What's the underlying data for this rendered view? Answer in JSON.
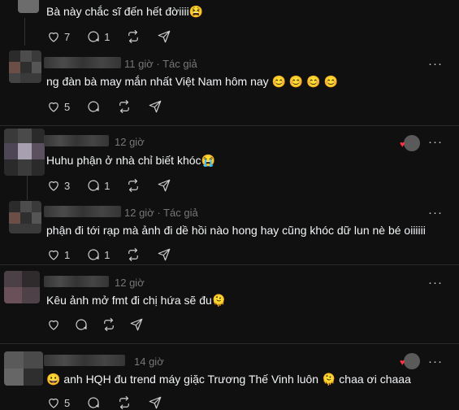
{
  "comments": [
    {
      "text": "Bà này chắc sĩ đến hết đời​iii😫",
      "time": "",
      "tag": "",
      "likes": "7",
      "replies": "1",
      "reposts": ""
    },
    {
      "text": "ng đàn bà may mắn nhất Việt Nam hôm nay 😊 😊 😊 😊",
      "time": "11 giờ",
      "tag": "· Tác giả",
      "likes": "5",
      "replies": "",
      "reposts": ""
    },
    {
      "text": "Huhu phận ở nhà chỉ biết khóc😭",
      "time": "12 giờ",
      "tag": "",
      "likes": "3",
      "replies": "1",
      "reposts": ""
    },
    {
      "text": "phận đi tới rạp mà ảnh đi dề hồi nào hong hay cũng khóc dữ lun nè bé oiiiiii",
      "time": "12 giờ",
      "tag": "· Tác giả",
      "likes": "1",
      "replies": "1",
      "reposts": ""
    },
    {
      "text": "Kêu ảnh mở fmt đi chị hứa sẽ đu🫠",
      "time": "12 giờ",
      "tag": "",
      "likes": "",
      "replies": "",
      "reposts": ""
    },
    {
      "text": "😀 anh HQH đu trend máy giặc Trương Thế Vinh luôn 🫠 chaa ơi chaaa",
      "time": "14 giờ",
      "tag": "",
      "likes": "5",
      "replies": "",
      "reposts": ""
    }
  ],
  "more_label": "···",
  "icons": {
    "like": "heart-icon",
    "reply": "comment-icon",
    "repost": "repost-icon",
    "share": "share-icon"
  }
}
